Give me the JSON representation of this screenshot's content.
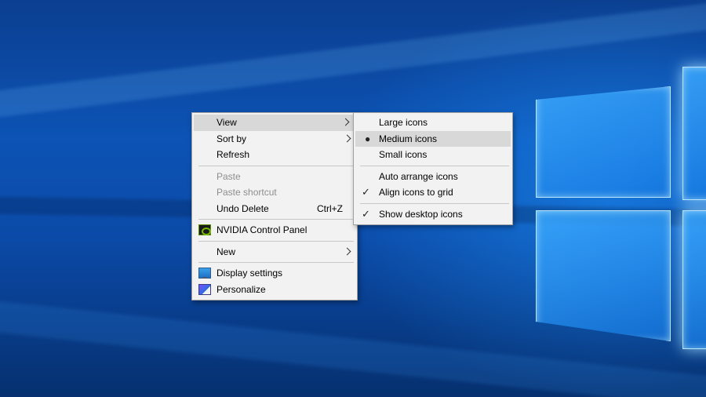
{
  "context_menu": {
    "items": [
      {
        "label": "View"
      },
      {
        "label": "Sort by"
      },
      {
        "label": "Refresh"
      },
      {
        "label": "Paste"
      },
      {
        "label": "Paste shortcut"
      },
      {
        "label": "Undo Delete",
        "shortcut": "Ctrl+Z"
      },
      {
        "label": "NVIDIA Control Panel"
      },
      {
        "label": "New"
      },
      {
        "label": "Display settings"
      },
      {
        "label": "Personalize"
      }
    ]
  },
  "view_submenu": {
    "items": [
      {
        "label": "Large icons"
      },
      {
        "label": "Medium icons",
        "mark": "●"
      },
      {
        "label": "Small icons"
      },
      {
        "label": "Auto arrange icons"
      },
      {
        "label": "Align icons to grid",
        "mark": "✓"
      },
      {
        "label": "Show desktop icons",
        "mark": "✓"
      }
    ]
  },
  "colors": {
    "menu_bg": "#f2f2f2",
    "hover_bg": "#d8d8d8",
    "disabled_text": "#8e8e8e",
    "desktop_blue": "#0c53b5"
  }
}
